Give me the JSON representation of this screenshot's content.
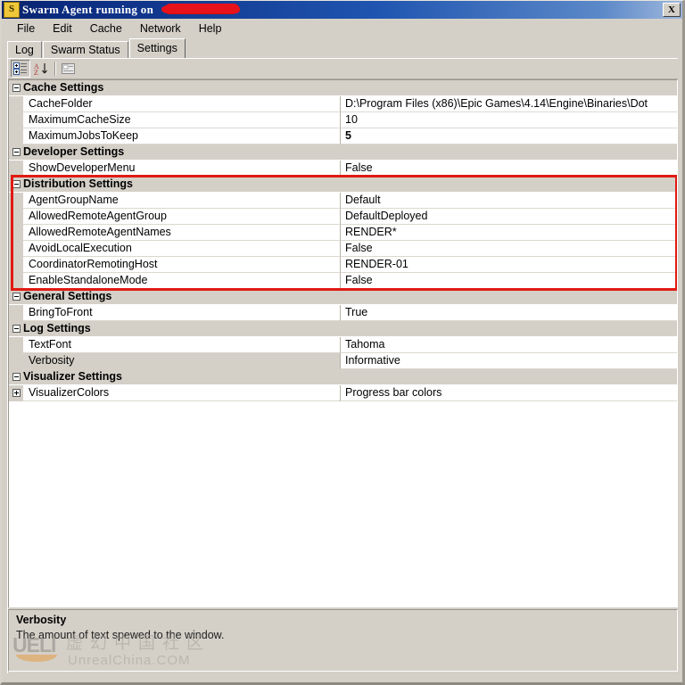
{
  "window": {
    "title": "Swarm Agent running on ",
    "icon": "swarm-agent-icon",
    "close_label": "X",
    "redacted_hostname": ""
  },
  "menu": {
    "items": [
      {
        "label": "File"
      },
      {
        "label": "Edit"
      },
      {
        "label": "Cache"
      },
      {
        "label": "Network"
      },
      {
        "label": "Help"
      }
    ]
  },
  "tabs": {
    "items": [
      {
        "label": "Log",
        "active": false
      },
      {
        "label": "Swarm Status",
        "active": false
      },
      {
        "label": "Settings",
        "active": true
      }
    ]
  },
  "toolbar": {
    "buttons": [
      {
        "name": "categorized-view-button",
        "title": "Categorized"
      },
      {
        "name": "alphabetical-sort-button",
        "title": "Alphabetical"
      },
      {
        "name": "property-pages-button",
        "title": "Property Pages"
      }
    ]
  },
  "grid": {
    "categories": [
      {
        "label": "Cache Settings",
        "expanded": true,
        "rows": [
          {
            "name": "CacheFolder",
            "value": "D:\\Program Files (x86)\\Epic Games\\4.14\\Engine\\Binaries\\Dot",
            "bold": false,
            "selected": false,
            "expandable": false
          },
          {
            "name": "MaximumCacheSize",
            "value": "10",
            "bold": false,
            "selected": false,
            "expandable": false
          },
          {
            "name": "MaximumJobsToKeep",
            "value": "5",
            "bold": true,
            "selected": false,
            "expandable": false
          }
        ]
      },
      {
        "label": "Developer Settings",
        "expanded": true,
        "rows": [
          {
            "name": "ShowDeveloperMenu",
            "value": "False",
            "bold": false,
            "selected": false,
            "expandable": false
          }
        ]
      },
      {
        "label": "Distribution Settings",
        "expanded": true,
        "highlighted": true,
        "rows": [
          {
            "name": "AgentGroupName",
            "value": "Default",
            "bold": false,
            "selected": false,
            "expandable": false
          },
          {
            "name": "AllowedRemoteAgentGroup",
            "value": "DefaultDeployed",
            "bold": false,
            "selected": false,
            "expandable": false
          },
          {
            "name": "AllowedRemoteAgentNames",
            "value": "RENDER*",
            "bold": false,
            "selected": false,
            "expandable": false
          },
          {
            "name": "AvoidLocalExecution",
            "value": "False",
            "bold": false,
            "selected": false,
            "expandable": false
          },
          {
            "name": "CoordinatorRemotingHost",
            "value": "RENDER-01",
            "bold": false,
            "selected": false,
            "expandable": false
          },
          {
            "name": "EnableStandaloneMode",
            "value": "False",
            "bold": false,
            "selected": false,
            "expandable": false
          }
        ]
      },
      {
        "label": "General Settings",
        "expanded": true,
        "rows": [
          {
            "name": "BringToFront",
            "value": "True",
            "bold": false,
            "selected": false,
            "expandable": false
          }
        ]
      },
      {
        "label": "Log Settings",
        "expanded": true,
        "rows": [
          {
            "name": "TextFont",
            "value": "Tahoma",
            "bold": false,
            "selected": false,
            "expandable": false
          },
          {
            "name": "Verbosity",
            "value": "Informative",
            "bold": false,
            "selected": true,
            "expandable": false
          }
        ]
      },
      {
        "label": "Visualizer Settings",
        "expanded": true,
        "rows": [
          {
            "name": "VisualizerColors",
            "value": "Progress bar colors",
            "bold": false,
            "selected": false,
            "expandable": true
          }
        ]
      }
    ]
  },
  "description": {
    "title": "Verbosity",
    "text": "The amount of text spewed to the window."
  },
  "watermark": {
    "logo": "UELI",
    "chinese": "虚幻中国社区",
    "site": "UnrealChina.COM"
  },
  "colors": {
    "titlebar_start": "#0b246a",
    "titlebar_end": "#9fb8dd",
    "window_face": "#d4d0c8",
    "annotation_red": "#e01a12",
    "redaction_red": "#e8121a",
    "grid_background": "#ffffff",
    "watermark_orange": "#e8922c"
  }
}
